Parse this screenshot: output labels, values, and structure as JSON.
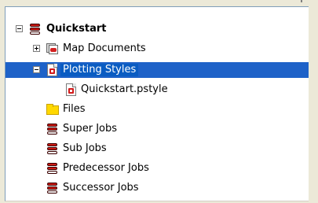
{
  "tree": {
    "root": {
      "label": "Quickstart",
      "expander": "minus",
      "icon": "job-stack-icon"
    },
    "items": [
      {
        "label": "Map Documents",
        "expander": "plus",
        "icon": "map-documents-icon"
      },
      {
        "label": "Plotting Styles",
        "expander": "minus",
        "icon": "plot-style-icon",
        "selected": true
      },
      {
        "label": "Quickstart.pstyle",
        "icon": "plot-style-file-icon"
      },
      {
        "label": "Files",
        "icon": "folder-icon"
      },
      {
        "label": "Super Jobs",
        "icon": "job-stack-icon"
      },
      {
        "label": "Sub Jobs",
        "icon": "job-stack-icon"
      },
      {
        "label": "Predecessor Jobs",
        "icon": "job-stack-icon"
      },
      {
        "label": "Successor Jobs",
        "icon": "job-stack-icon"
      }
    ]
  },
  "colors": {
    "selection": "#1e62c8",
    "background": "#ffffff",
    "chrome": "#ece9d8"
  }
}
